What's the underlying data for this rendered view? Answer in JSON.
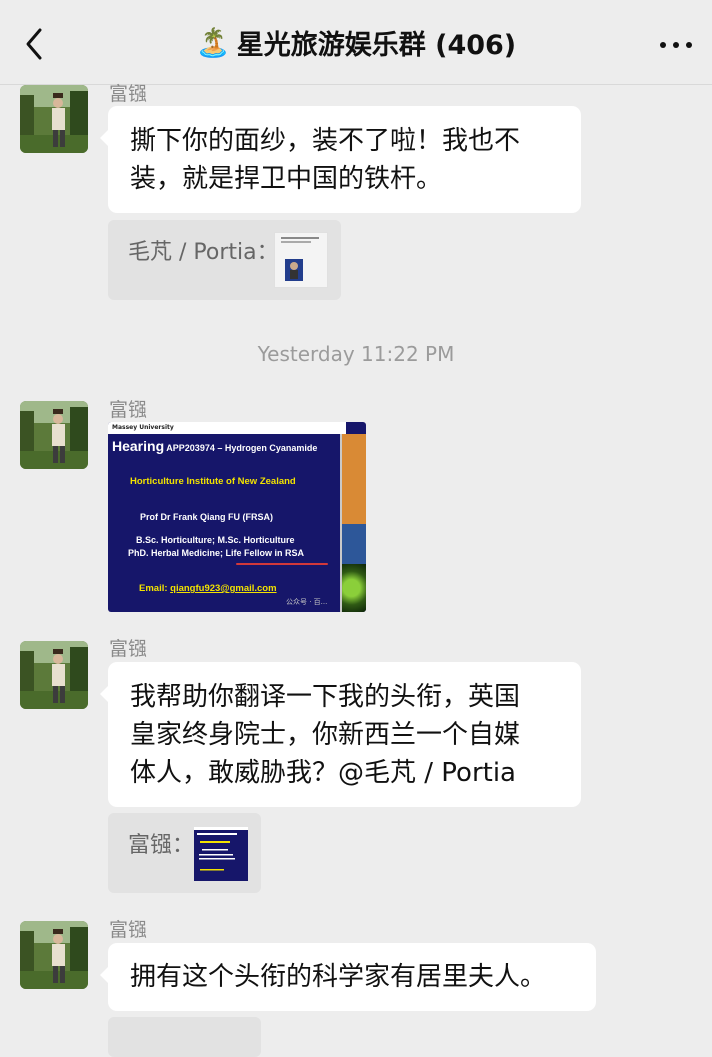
{
  "header": {
    "back_icon": "chevron-left-icon",
    "emoji": "🏝️",
    "title": "星光旅游娱乐群 (406)",
    "more_icon": "more-dots-icon"
  },
  "messages": [
    {
      "sender": "富镪",
      "text_line1": "撕下你的面纱，装不了啦！我也不",
      "text_line2": "装，就是捍卫中国的铁杆。",
      "quote_label": "毛芃 / Portia："
    },
    {
      "sender": "富镪",
      "image": {
        "header": "Massey University",
        "title_bold": "Hearing",
        "title_rest": " APP203974 – Hydrogen Cyanamide",
        "line1": "Horticulture Institute of New Zealand",
        "line2": "Prof  Dr   Frank Qiang FU  (FRSA)",
        "line3": "B.Sc. Horticulture; M.Sc. Horticulture",
        "line4": "PhD. Herbal Medicine; Life Fellow in RSA",
        "email_label": "Email: ",
        "email": "qiangfu923@gmail.com",
        "watermark": "公众号 · 百..."
      }
    },
    {
      "sender": "富镪",
      "text_line1": "我帮助你翻译一下我的头衔，英国",
      "text_line2": "皇家终身院士，你新西兰一个自媒",
      "text_line3": "体人，敢威胁我？@毛芃 / Portia",
      "quote_label": "富镪："
    },
    {
      "sender": "富镪",
      "text_line1": "拥有这个头衔的科学家有居里夫人。"
    }
  ],
  "timestamp": "Yesterday 11:22 PM"
}
